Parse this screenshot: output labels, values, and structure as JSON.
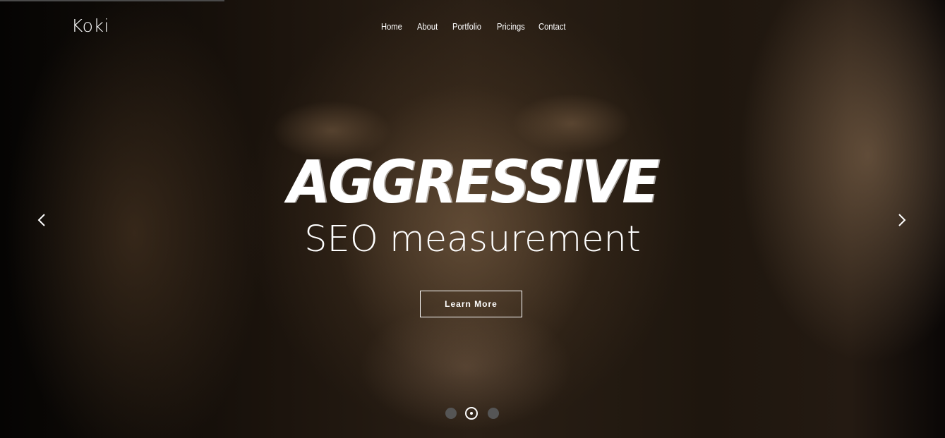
{
  "brand": {
    "name": "Koki"
  },
  "nav": {
    "items": [
      {
        "label": "Home"
      },
      {
        "label": "About"
      },
      {
        "label": "Portfolio"
      },
      {
        "label": "Pricings"
      },
      {
        "label": "Contact"
      }
    ]
  },
  "hero": {
    "headline": "AGGRESSIVE",
    "subheadline": "SEO measurement",
    "cta_label": "Learn More"
  },
  "slider": {
    "prev_icon": "chevron-left-icon",
    "next_icon": "chevron-right-icon",
    "total_slides": 3,
    "active_slide": 2
  },
  "colors": {
    "text": "#ffffff",
    "dot_inactive": "#555555",
    "background": "#000000"
  }
}
